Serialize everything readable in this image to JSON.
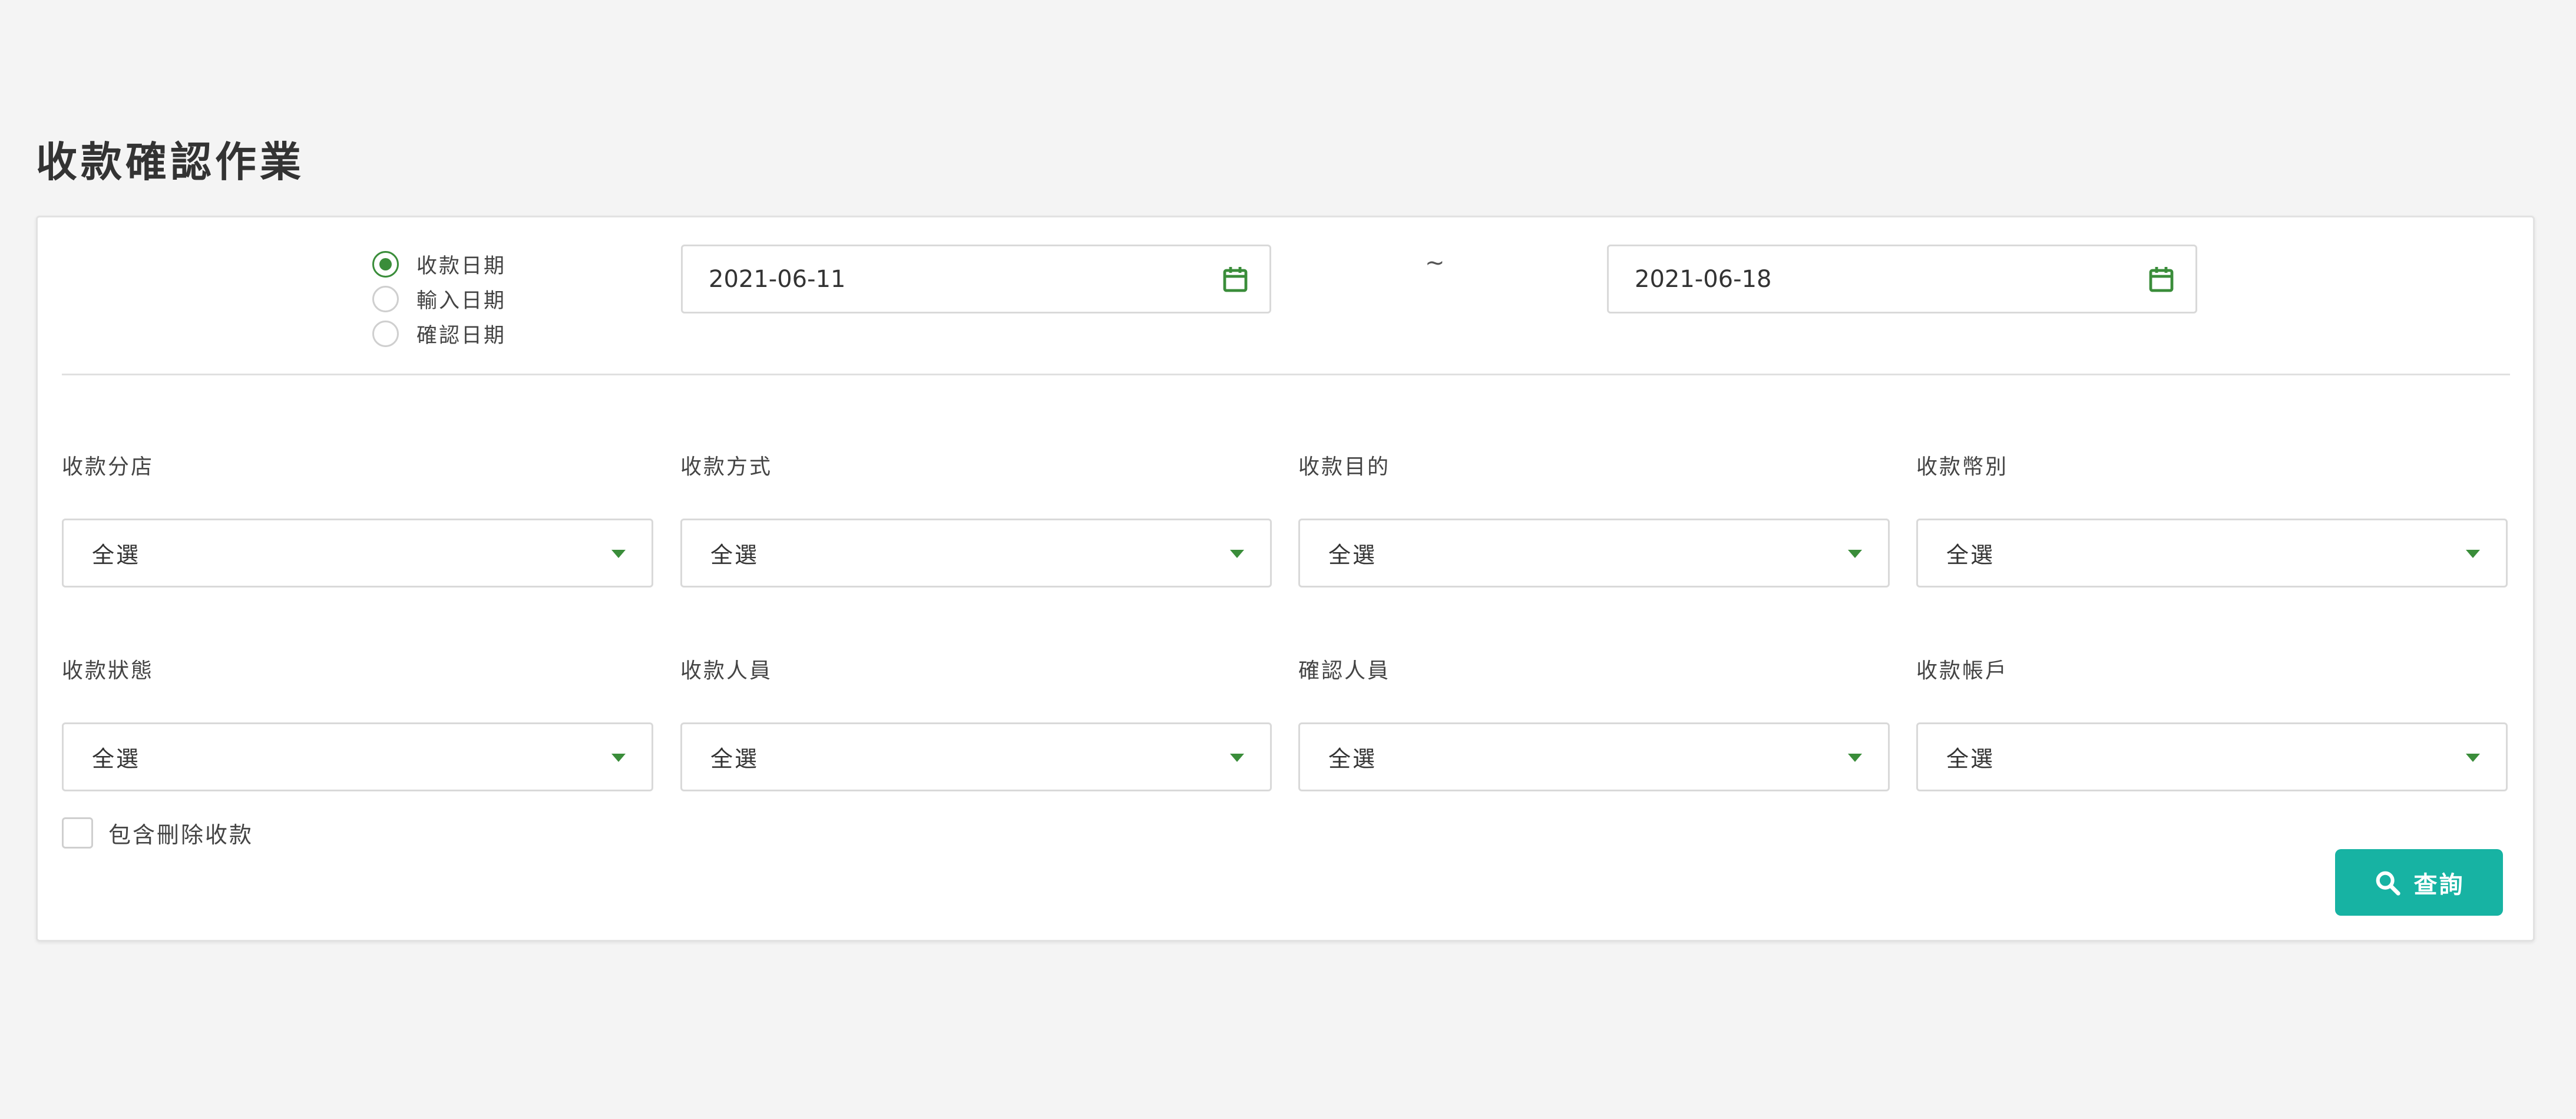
{
  "page": {
    "title": "收款確認作業"
  },
  "date_filter": {
    "options": [
      {
        "label": "收款日期",
        "checked": true
      },
      {
        "label": "輸入日期",
        "checked": false
      },
      {
        "label": "確認日期",
        "checked": false
      }
    ],
    "start_date": "2021-06-11",
    "separator": "~",
    "end_date": "2021-06-18",
    "calendar_icon": "calendar-icon"
  },
  "filters": [
    {
      "label": "收款分店",
      "value": "全選"
    },
    {
      "label": "收款方式",
      "value": "全選"
    },
    {
      "label": "收款目的",
      "value": "全選"
    },
    {
      "label": "收款幣別",
      "value": "全選"
    },
    {
      "label": "收款狀態",
      "value": "全選"
    },
    {
      "label": "收款人員",
      "value": "全選"
    },
    {
      "label": "確認人員",
      "value": "全選"
    },
    {
      "label": "收款帳戶",
      "value": "全選"
    }
  ],
  "include_deleted": {
    "label": "包含刪除收款",
    "checked": false
  },
  "query_button": {
    "label": "查詢",
    "icon": "search-icon"
  },
  "colors": {
    "accent_green": "#3a8d3a",
    "button_teal": "#17b3a3",
    "background": "#f4f4f4"
  }
}
